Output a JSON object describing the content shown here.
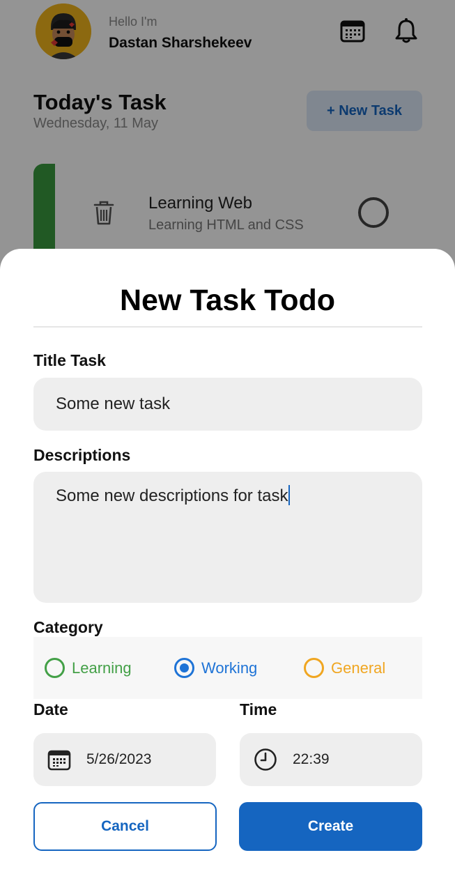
{
  "header": {
    "greeting": "Hello I'm",
    "user_name": "Dastan Sharshekeev",
    "avatar_icon": "avatar-emoji",
    "calendar_icon": "calendar-icon",
    "bell_icon": "bell-icon"
  },
  "today": {
    "title": "Today's Task",
    "date": "Wednesday, 11 May",
    "new_task_label": "+ New Task"
  },
  "task": {
    "title": "Learning Web",
    "description": "Learning HTML and CSS",
    "stripe_color": "#3a9a3f"
  },
  "sheet": {
    "title": "New Task Todo",
    "title_label": "Title Task",
    "title_value": "Some new task",
    "desc_label": "Descriptions",
    "desc_value": "Some new descriptions for task",
    "category_label": "Category",
    "categories": [
      {
        "label": "Learning",
        "color": "#43a047",
        "selected": false
      },
      {
        "label": "Working",
        "color": "#1e73d6",
        "selected": true
      },
      {
        "label": "General",
        "color": "#f0a621",
        "selected": false
      }
    ],
    "date_label": "Date",
    "date_value": "5/26/2023",
    "time_label": "Time",
    "time_value": "22:39",
    "cancel_label": "Cancel",
    "create_label": "Create"
  },
  "colors": {
    "accent": "#1565c0",
    "overlay": "rgba(0,0,0,0.42)"
  }
}
